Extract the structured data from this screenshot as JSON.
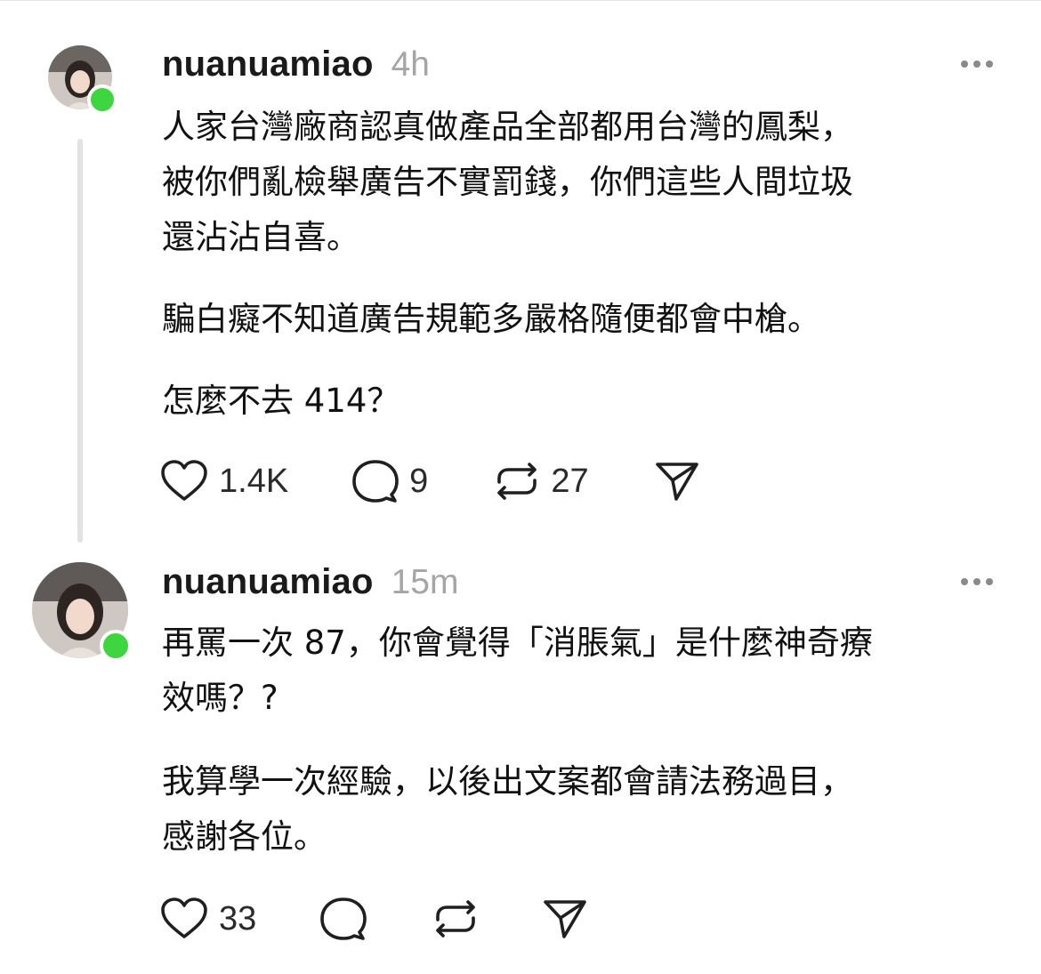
{
  "posts": [
    {
      "username": "nuanuamiao",
      "time": "4h",
      "paragraphs": [
        [
          "人家台灣廠商認真做產品全部都用台灣的鳳梨，",
          "被你們亂檢舉廣告不實罰錢，你們這些人間垃圾",
          "還沾沾自喜。"
        ],
        [
          "騙白癡不知道廣告規範多嚴格隨便都會中槍。"
        ],
        [
          "怎麼不去 414？"
        ]
      ],
      "likes": "1.4K",
      "replies": "9",
      "reposts": "27",
      "online": true
    },
    {
      "username": "nuanuamiao",
      "time": "15m",
      "paragraphs": [
        [
          "再罵一次 87，你會覺得「消脹氣」是什麼神奇療",
          "效嗎？?"
        ],
        [
          "我算學一次經驗，以後出文案都會請法務過目，",
          "感謝各位。"
        ]
      ],
      "likes": "33",
      "replies": "",
      "reposts": "",
      "online": true
    }
  ],
  "icons": {
    "like": "heart-icon",
    "reply": "comment-icon",
    "repost": "repost-icon",
    "share": "send-icon",
    "more": "more-options-icon"
  },
  "colors": {
    "online": "#3dd63f",
    "muted": "#a5a5a5",
    "thread_line": "#e3e3e3"
  }
}
